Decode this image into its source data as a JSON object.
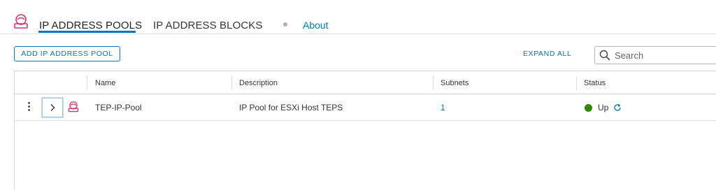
{
  "header": {
    "app_icon": "network-pool-icon",
    "tabs": [
      {
        "label": "IP ADDRESS POOLS",
        "active": true
      },
      {
        "label": "IP ADDRESS BLOCKS",
        "active": false
      }
    ],
    "about_label": "About"
  },
  "toolbar": {
    "add_label": "ADD IP ADDRESS POOL",
    "expand_all_label": "EXPAND ALL",
    "search_placeholder": "Search",
    "search_value": ""
  },
  "table": {
    "columns": [
      "Name",
      "Description",
      "Subnets",
      "Status"
    ],
    "rows": [
      {
        "name": "TEP-IP-Pool",
        "description": "IP Pool for ESXi Host TEPS",
        "subnets": "1",
        "status": "Up",
        "status_color": "#318700",
        "row_icon": "network-pool-icon"
      }
    ]
  },
  "colors": {
    "accent": "#0079b8",
    "app_icon": "#d6336c"
  }
}
